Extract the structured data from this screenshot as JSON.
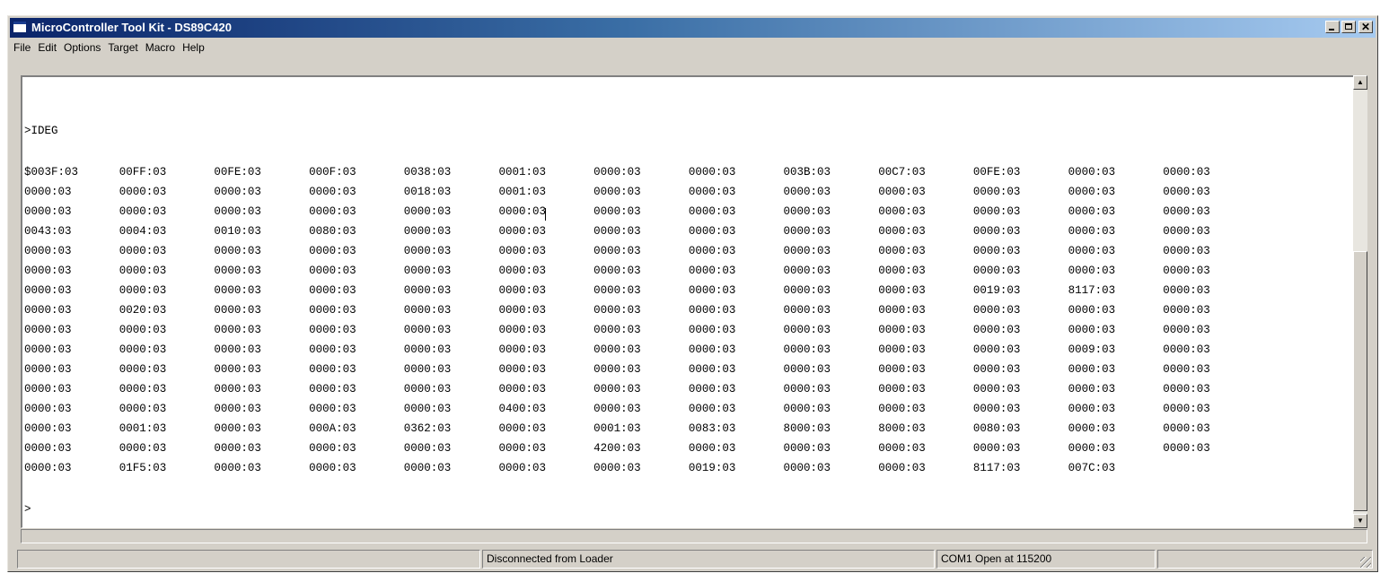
{
  "window": {
    "title": "MicroController Tool Kit - DS89C420"
  },
  "menu": [
    "File",
    "Edit",
    "Options",
    "Target",
    "Macro",
    "Help"
  ],
  "terminal": {
    "command": ">IDEG",
    "rows": [
      [
        "$003F:03",
        "00FF:03",
        "00FE:03",
        "000F:03",
        "0038:03",
        "0001:03",
        "0000:03",
        "0000:03",
        "003B:03",
        "00C7:03",
        "00FE:03",
        "0000:03",
        "0000:03"
      ],
      [
        "0000:03",
        "0000:03",
        "0000:03",
        "0000:03",
        "0018:03",
        "0001:03",
        "0000:03",
        "0000:03",
        "0000:03",
        "0000:03",
        "0000:03",
        "0000:03",
        "0000:03"
      ],
      [
        "0000:03",
        "0000:03",
        "0000:03",
        "0000:03",
        "0000:03",
        "0000:03",
        "0000:03",
        "0000:03",
        "0000:03",
        "0000:03",
        "0000:03",
        "0000:03",
        "0000:03"
      ],
      [
        "0043:03",
        "0004:03",
        "0010:03",
        "0080:03",
        "0000:03",
        "0000:03",
        "0000:03",
        "0000:03",
        "0000:03",
        "0000:03",
        "0000:03",
        "0000:03",
        "0000:03"
      ],
      [
        "0000:03",
        "0000:03",
        "0000:03",
        "0000:03",
        "0000:03",
        "0000:03",
        "0000:03",
        "0000:03",
        "0000:03",
        "0000:03",
        "0000:03",
        "0000:03",
        "0000:03"
      ],
      [
        "0000:03",
        "0000:03",
        "0000:03",
        "0000:03",
        "0000:03",
        "0000:03",
        "0000:03",
        "0000:03",
        "0000:03",
        "0000:03",
        "0000:03",
        "0000:03",
        "0000:03"
      ],
      [
        "0000:03",
        "0000:03",
        "0000:03",
        "0000:03",
        "0000:03",
        "0000:03",
        "0000:03",
        "0000:03",
        "0000:03",
        "0000:03",
        "0019:03",
        "8117:03",
        "0000:03"
      ],
      [
        "0000:03",
        "0020:03",
        "0000:03",
        "0000:03",
        "0000:03",
        "0000:03",
        "0000:03",
        "0000:03",
        "0000:03",
        "0000:03",
        "0000:03",
        "0000:03",
        "0000:03"
      ],
      [
        "0000:03",
        "0000:03",
        "0000:03",
        "0000:03",
        "0000:03",
        "0000:03",
        "0000:03",
        "0000:03",
        "0000:03",
        "0000:03",
        "0000:03",
        "0000:03",
        "0000:03"
      ],
      [
        "0000:03",
        "0000:03",
        "0000:03",
        "0000:03",
        "0000:03",
        "0000:03",
        "0000:03",
        "0000:03",
        "0000:03",
        "0000:03",
        "0000:03",
        "0009:03",
        "0000:03"
      ],
      [
        "0000:03",
        "0000:03",
        "0000:03",
        "0000:03",
        "0000:03",
        "0000:03",
        "0000:03",
        "0000:03",
        "0000:03",
        "0000:03",
        "0000:03",
        "0000:03",
        "0000:03"
      ],
      [
        "0000:03",
        "0000:03",
        "0000:03",
        "0000:03",
        "0000:03",
        "0000:03",
        "0000:03",
        "0000:03",
        "0000:03",
        "0000:03",
        "0000:03",
        "0000:03",
        "0000:03"
      ],
      [
        "0000:03",
        "0000:03",
        "0000:03",
        "0000:03",
        "0000:03",
        "0400:03",
        "0000:03",
        "0000:03",
        "0000:03",
        "0000:03",
        "0000:03",
        "0000:03",
        "0000:03"
      ],
      [
        "0000:03",
        "0001:03",
        "0000:03",
        "000A:03",
        "0362:03",
        "0000:03",
        "0001:03",
        "0083:03",
        "8000:03",
        "8000:03",
        "0080:03",
        "0000:03",
        "0000:03"
      ],
      [
        "0000:03",
        "0000:03",
        "0000:03",
        "0000:03",
        "0000:03",
        "0000:03",
        "4200:03",
        "0000:03",
        "0000:03",
        "0000:03",
        "0000:03",
        "0000:03",
        "0000:03"
      ],
      [
        "0000:03",
        "01F5:03",
        "0000:03",
        "0000:03",
        "0000:03",
        "0000:03",
        "0000:03",
        "0019:03",
        "0000:03",
        "0000:03",
        "8117:03",
        "007C:03"
      ]
    ],
    "prompt": ">"
  },
  "status": {
    "panel1": "",
    "panel2": "Disconnected from Loader",
    "panel3": "COM1 Open at 115200",
    "panel4": ""
  }
}
